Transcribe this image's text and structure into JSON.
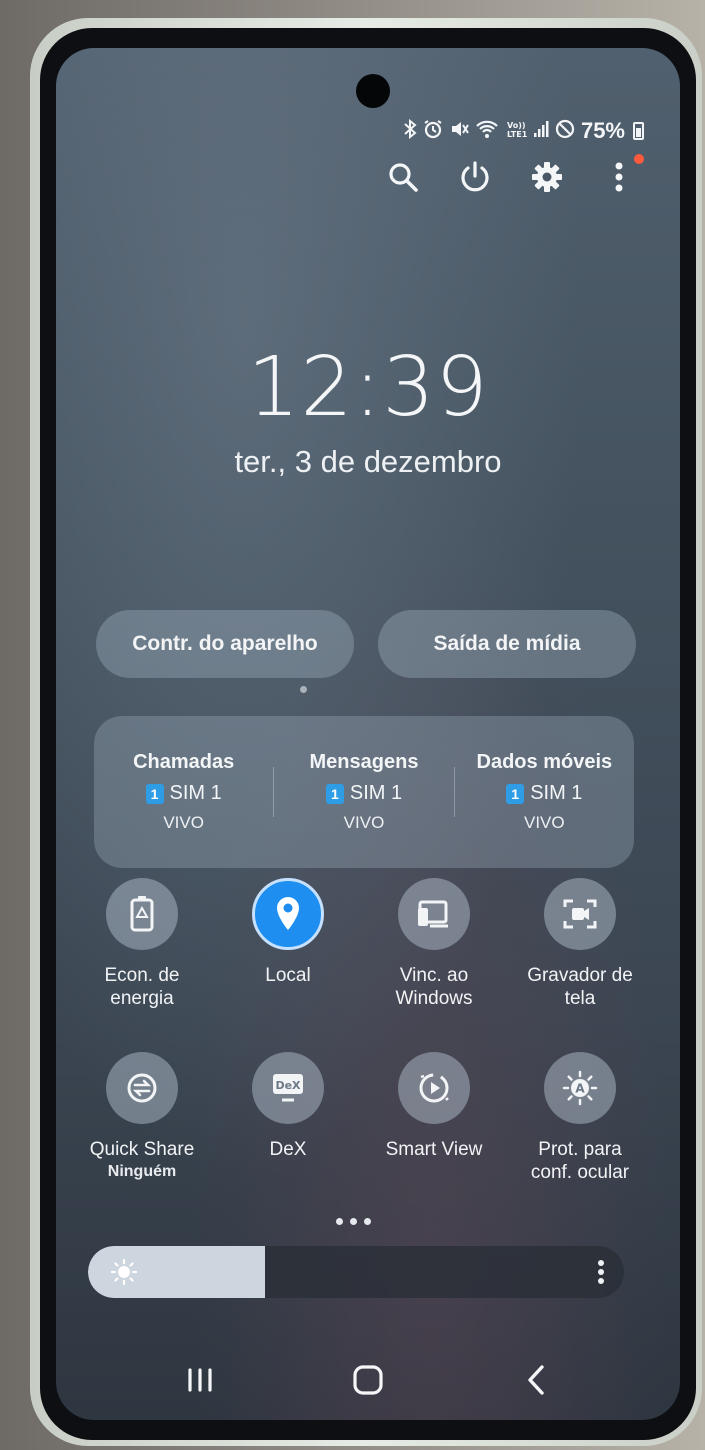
{
  "status_bar": {
    "icons": [
      "bluetooth-icon",
      "alarm-icon",
      "mute-icon",
      "wifi-icon",
      "volte-icon",
      "signal-icon",
      "do-not-disturb-icon",
      "battery-icon"
    ],
    "battery_text": "75%"
  },
  "top_actions": {
    "icons": [
      "search-icon",
      "power-icon",
      "settings-icon",
      "more-icon"
    ],
    "notification_dot_color": "#ff5a3c"
  },
  "lock": {
    "time": "12:39",
    "date": "ter., 3 de dezembro"
  },
  "pills": {
    "device_control": "Contr. do aparelho",
    "media_output": "Saída de mídia"
  },
  "sim": {
    "columns": [
      {
        "title": "Chamadas",
        "badge": "1",
        "sim": "SIM 1",
        "carrier": "VIVO"
      },
      {
        "title": "Mensagens",
        "badge": "1",
        "sim": "SIM 1",
        "carrier": "VIVO"
      },
      {
        "title": "Dados móveis",
        "badge": "1",
        "sim": "SIM 1",
        "carrier": "VIVO"
      }
    ]
  },
  "tiles": [
    {
      "label": "Econ. de\nenergia",
      "icon": "battery-saver-icon",
      "active": false
    },
    {
      "label": "Local",
      "icon": "location-icon",
      "active": true
    },
    {
      "label": "Vinc. ao\nWindows",
      "icon": "link-windows-icon",
      "active": false
    },
    {
      "label": "Gravador de\ntela",
      "icon": "screen-recorder-icon",
      "active": false
    },
    {
      "label": "Quick Share",
      "sub": "Ninguém",
      "icon": "quick-share-icon",
      "active": false
    },
    {
      "label": "DeX",
      "icon": "dex-icon",
      "active": false,
      "icon_text": "DeX"
    },
    {
      "label": "Smart View",
      "icon": "smart-view-icon",
      "active": false
    },
    {
      "label": "Prot. para\nconf. ocular",
      "icon": "eye-comfort-icon",
      "active": false,
      "icon_text": "A"
    }
  ],
  "brightness": {
    "level": 0.33
  },
  "navbar": {
    "icons": [
      "recents-icon",
      "home-icon",
      "back-icon"
    ]
  },
  "colors": {
    "accent": "#1e8ff0",
    "sim_badge": "#2e9de6"
  }
}
